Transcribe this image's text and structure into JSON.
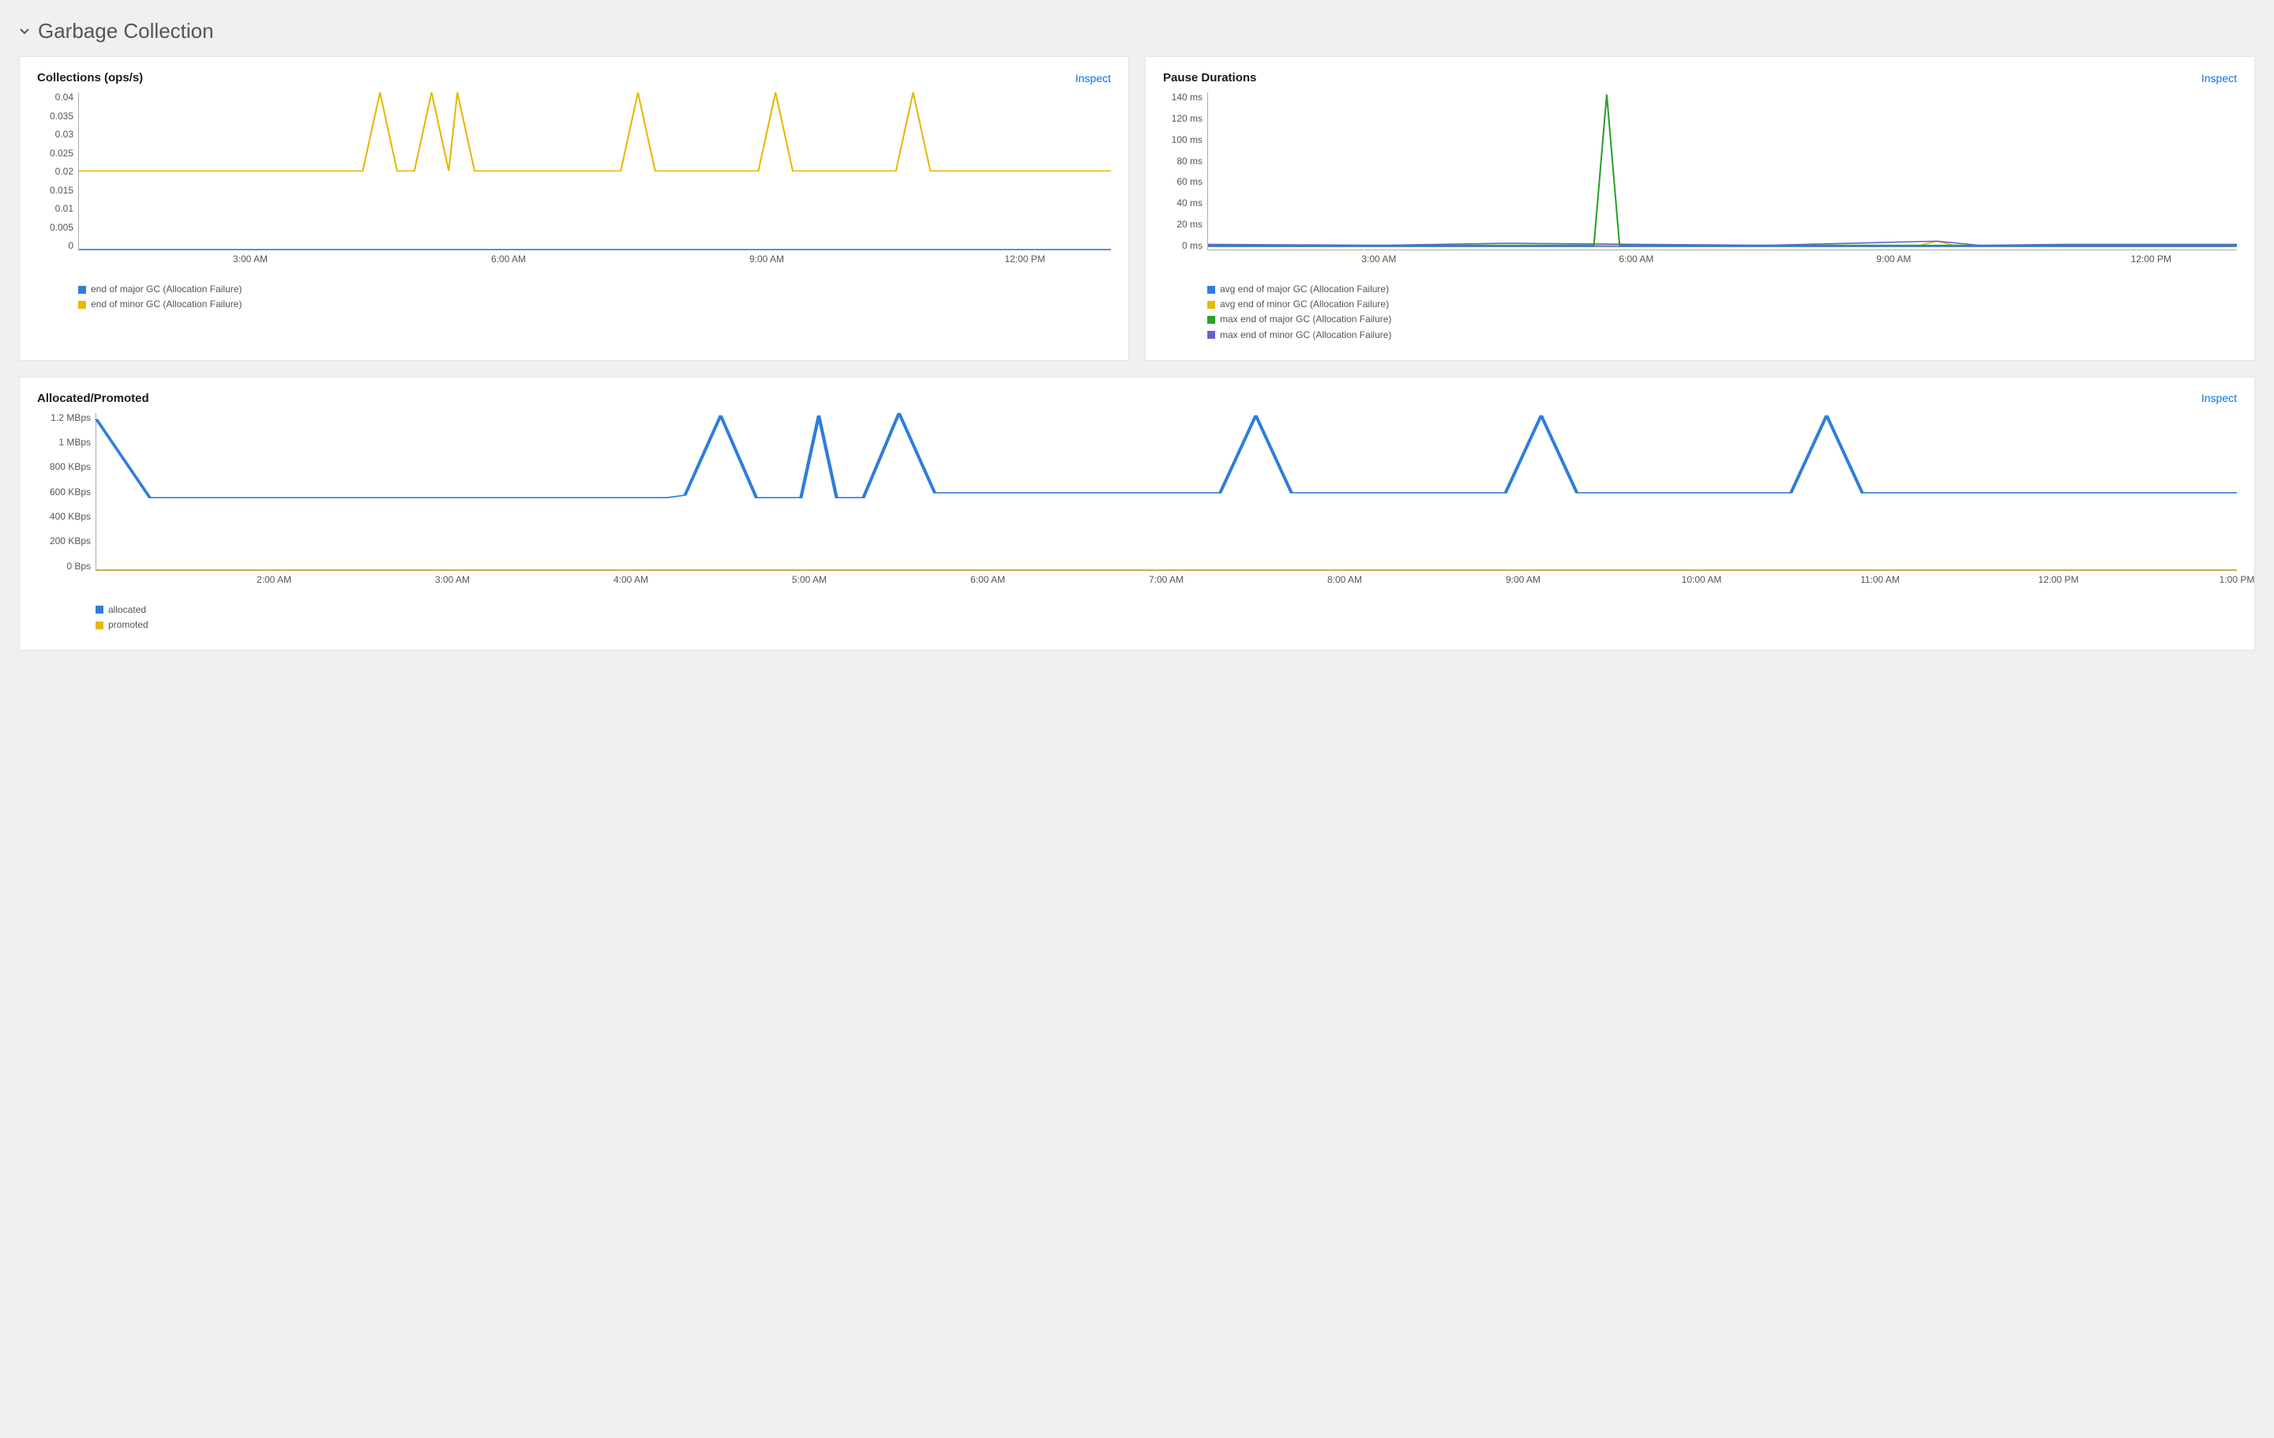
{
  "section": {
    "title": "Garbage Collection"
  },
  "panels": {
    "collections": {
      "title": "Collections (ops/s)",
      "inspect_label": "Inspect"
    },
    "pause": {
      "title": "Pause Durations",
      "inspect_label": "Inspect"
    },
    "alloc": {
      "title": "Allocated/Promoted",
      "inspect_label": "Inspect"
    }
  },
  "colors": {
    "blue": "#2f7ed8",
    "yellow": "#e6b800",
    "green": "#2ca02c",
    "purple": "#6b5ecf"
  },
  "chart_data": [
    {
      "id": "collections",
      "type": "line",
      "title": "Collections (ops/s)",
      "ylabel": "",
      "ylim": [
        0,
        0.04
      ],
      "y_ticks": [
        "0.04",
        "0.035",
        "0.03",
        "0.025",
        "0.02",
        "0.015",
        "0.01",
        "0.005",
        "0"
      ],
      "x_range_hours": [
        1,
        13
      ],
      "x_ticks": [
        {
          "h": 3,
          "label": "3:00 AM"
        },
        {
          "h": 6,
          "label": "6:00 AM"
        },
        {
          "h": 9,
          "label": "9:00 AM"
        },
        {
          "h": 12,
          "label": "12:00 PM"
        }
      ],
      "series": [
        {
          "name": "end of major GC (Allocation Failure)",
          "color": "blue",
          "points": [
            {
              "h": 1.0,
              "v": 0
            },
            {
              "h": 13.0,
              "v": 0
            }
          ]
        },
        {
          "name": "end of minor GC (Allocation Failure)",
          "color": "yellow",
          "points": [
            {
              "h": 1.0,
              "v": 0.02
            },
            {
              "h": 4.3,
              "v": 0.02
            },
            {
              "h": 4.5,
              "v": 0.04
            },
            {
              "h": 4.7,
              "v": 0.02
            },
            {
              "h": 4.9,
              "v": 0.02
            },
            {
              "h": 5.1,
              "v": 0.04
            },
            {
              "h": 5.3,
              "v": 0.02
            },
            {
              "h": 5.4,
              "v": 0.04
            },
            {
              "h": 5.6,
              "v": 0.02
            },
            {
              "h": 7.3,
              "v": 0.02
            },
            {
              "h": 7.5,
              "v": 0.04
            },
            {
              "h": 7.7,
              "v": 0.02
            },
            {
              "h": 8.9,
              "v": 0.02
            },
            {
              "h": 9.1,
              "v": 0.04
            },
            {
              "h": 9.3,
              "v": 0.02
            },
            {
              "h": 10.5,
              "v": 0.02
            },
            {
              "h": 10.7,
              "v": 0.04
            },
            {
              "h": 10.9,
              "v": 0.02
            },
            {
              "h": 13.0,
              "v": 0.02
            }
          ]
        }
      ]
    },
    {
      "id": "pause",
      "type": "line",
      "title": "Pause Durations",
      "ylabel": "",
      "ylim": [
        0,
        150
      ],
      "y_ticks": [
        "140 ms",
        "120 ms",
        "100 ms",
        "80 ms",
        "60 ms",
        "40 ms",
        "20 ms",
        "0 ms"
      ],
      "x_range_hours": [
        1,
        13
      ],
      "x_ticks": [
        {
          "h": 3,
          "label": "3:00 AM"
        },
        {
          "h": 6,
          "label": "6:00 AM"
        },
        {
          "h": 9,
          "label": "9:00 AM"
        },
        {
          "h": 12,
          "label": "12:00 PM"
        }
      ],
      "series": [
        {
          "name": "avg end of major GC (Allocation Failure)",
          "color": "blue",
          "points": [
            {
              "h": 1.0,
              "v": 3
            },
            {
              "h": 13.0,
              "v": 3
            }
          ]
        },
        {
          "name": "avg end of minor GC (Allocation Failure)",
          "color": "yellow",
          "points": [
            {
              "h": 1.0,
              "v": 4
            },
            {
              "h": 9.3,
              "v": 4
            },
            {
              "h": 9.5,
              "v": 8
            },
            {
              "h": 9.7,
              "v": 4
            },
            {
              "h": 13.0,
              "v": 4
            }
          ]
        },
        {
          "name": "max end of major GC (Allocation Failure)",
          "color": "green",
          "points": [
            {
              "h": 1.0,
              "v": 4
            },
            {
              "h": 5.5,
              "v": 4
            },
            {
              "h": 5.65,
              "v": 148
            },
            {
              "h": 5.8,
              "v": 4
            },
            {
              "h": 13.0,
              "v": 4
            }
          ]
        },
        {
          "name": "max end of minor GC (Allocation Failure)",
          "color": "purple",
          "points": [
            {
              "h": 1.0,
              "v": 5
            },
            {
              "h": 3.0,
              "v": 4
            },
            {
              "h": 4.5,
              "v": 6
            },
            {
              "h": 6.0,
              "v": 5
            },
            {
              "h": 7.5,
              "v": 4
            },
            {
              "h": 8.5,
              "v": 6
            },
            {
              "h": 9.5,
              "v": 8
            },
            {
              "h": 10.0,
              "v": 4
            },
            {
              "h": 11.0,
              "v": 5
            },
            {
              "h": 13.0,
              "v": 5
            }
          ]
        }
      ]
    },
    {
      "id": "alloc",
      "type": "line",
      "title": "Allocated/Promoted",
      "ylabel": "",
      "ylim": [
        0,
        1300000
      ],
      "y_ticks": [
        "1.2 MBps",
        "1 MBps",
        "800 KBps",
        "600 KBps",
        "400 KBps",
        "200 KBps",
        "0 Bps"
      ],
      "y_tick_values": [
        1200000,
        1000000,
        800000,
        600000,
        400000,
        200000,
        0
      ],
      "x_range_hours": [
        1,
        13
      ],
      "x_ticks": [
        {
          "h": 2,
          "label": "2:00 AM"
        },
        {
          "h": 3,
          "label": "3:00 AM"
        },
        {
          "h": 4,
          "label": "4:00 AM"
        },
        {
          "h": 5,
          "label": "5:00 AM"
        },
        {
          "h": 6,
          "label": "6:00 AM"
        },
        {
          "h": 7,
          "label": "7:00 AM"
        },
        {
          "h": 8,
          "label": "8:00 AM"
        },
        {
          "h": 9,
          "label": "9:00 AM"
        },
        {
          "h": 10,
          "label": "10:00 AM"
        },
        {
          "h": 11,
          "label": "11:00 AM"
        },
        {
          "h": 12,
          "label": "12:00 PM"
        },
        {
          "h": 13,
          "label": "1:00 PM"
        }
      ],
      "series": [
        {
          "name": "allocated",
          "color": "blue",
          "points": [
            {
              "h": 1.0,
              "v": 1250000
            },
            {
              "h": 1.3,
              "v": 600000
            },
            {
              "h": 4.2,
              "v": 600000
            },
            {
              "h": 4.3,
              "v": 620000
            },
            {
              "h": 4.5,
              "v": 1280000
            },
            {
              "h": 4.7,
              "v": 600000
            },
            {
              "h": 4.95,
              "v": 600000
            },
            {
              "h": 5.05,
              "v": 1280000
            },
            {
              "h": 5.15,
              "v": 600000
            },
            {
              "h": 5.3,
              "v": 600000
            },
            {
              "h": 5.5,
              "v": 1300000
            },
            {
              "h": 5.7,
              "v": 640000
            },
            {
              "h": 7.3,
              "v": 640000
            },
            {
              "h": 7.5,
              "v": 1280000
            },
            {
              "h": 7.7,
              "v": 640000
            },
            {
              "h": 8.9,
              "v": 640000
            },
            {
              "h": 9.1,
              "v": 1280000
            },
            {
              "h": 9.3,
              "v": 640000
            },
            {
              "h": 10.5,
              "v": 640000
            },
            {
              "h": 10.7,
              "v": 1280000
            },
            {
              "h": 10.9,
              "v": 640000
            },
            {
              "h": 13.0,
              "v": 640000
            }
          ]
        },
        {
          "name": "promoted",
          "color": "yellow",
          "points": [
            {
              "h": 1.0,
              "v": 3000
            },
            {
              "h": 13.0,
              "v": 3000
            }
          ]
        }
      ]
    }
  ]
}
